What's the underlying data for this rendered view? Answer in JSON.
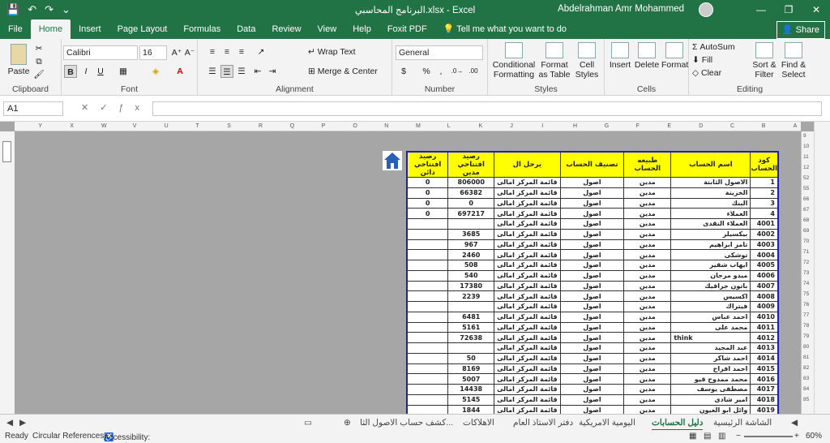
{
  "titlebar": {
    "title": "البرنامج المحاسبي.xlsx  -  Excel",
    "user": "Abdelrahman Amr Mohammed",
    "minimize": "—",
    "restore": "❐",
    "close": "✕"
  },
  "qat": {
    "save": "💾",
    "undo": "↶",
    "redo": "↷",
    "more": "⌄"
  },
  "tabs": [
    "File",
    "Home",
    "Insert",
    "Page Layout",
    "Formulas",
    "Data",
    "Review",
    "View",
    "Help",
    "Foxit PDF"
  ],
  "tell_me": "Tell me what you want to do",
  "share": "Share",
  "ribbon": {
    "clipboard": {
      "label": "Clipboard",
      "paste": "Paste"
    },
    "font": {
      "label": "Font",
      "name": "Calibri",
      "size": "16",
      "bold": "B",
      "italic": "I",
      "underline": "U"
    },
    "alignment": {
      "label": "Alignment",
      "wrap": "Wrap Text",
      "merge": "Merge & Center"
    },
    "number": {
      "label": "Number",
      "format": "General",
      "currency": "$",
      "percent": "%"
    },
    "styles": {
      "label": "Styles",
      "conditional": "Conditional Formatting",
      "format_table": "Format as Table",
      "cell_styles": "Cell Styles"
    },
    "cells": {
      "label": "Cells",
      "insert": "Insert",
      "delete": "Delete",
      "format": "Format"
    },
    "editing": {
      "label": "Editing",
      "autosum": "AutoSum",
      "fill": "Fill",
      "clear": "Clear",
      "sort": "Sort & Filter",
      "find": "Find & Select"
    }
  },
  "formula_bar": {
    "name_box": "A1",
    "value": ""
  },
  "columns": [
    "Y",
    "X",
    "W",
    "V",
    "U",
    "T",
    "S",
    "R",
    "Q",
    "P",
    "O",
    "N",
    "M",
    "L",
    "K",
    "J",
    "I",
    "H",
    "G",
    "F",
    "E",
    "D",
    "C",
    "B",
    "A"
  ],
  "rows": [
    "9",
    "10",
    "11",
    "12",
    "52",
    "55",
    "66",
    "67",
    "68",
    "69",
    "70",
    "71",
    "72",
    "73",
    "74",
    "75",
    "76",
    "77",
    "78",
    "79",
    "80",
    "81",
    "82",
    "83",
    "84",
    "85"
  ],
  "table": {
    "headers": [
      "كود الحساب",
      "اسم الحساب",
      "طبيعه الحساب",
      "تصنيف الحساب",
      "يرحل ال",
      "رصيد افتتاحي مدين",
      "رصيد افتتاحي دائن"
    ],
    "rows": [
      [
        "1",
        "الاصول الثابتة",
        "مدين",
        "اصول",
        "قائمة المركز امالى",
        "806000",
        "0"
      ],
      [
        "2",
        "الخزينة",
        "مدين",
        "اصول",
        "قائمة المركز امالى",
        "66382",
        "0"
      ],
      [
        "3",
        "البنك",
        "مدين",
        "اصول",
        "قائمة المركز امالى",
        "0",
        "0"
      ],
      [
        "4",
        "العملاء",
        "مدين",
        "اصول",
        "قائمة المركز امالى",
        "697217",
        "0"
      ],
      [
        "4001",
        "العملاء النقدى",
        "مدين",
        "اصول",
        "قائمة المركز امالى",
        "",
        ""
      ],
      [
        "4002",
        "بيكسيلز",
        "مدين",
        "اصول",
        "قائمة المركز امالى",
        "3685",
        ""
      ],
      [
        "4003",
        "تامر ابراهيم",
        "مدين",
        "اصول",
        "قائمة المركز امالى",
        "967",
        ""
      ],
      [
        "4004",
        "توشكى",
        "مدين",
        "اصول",
        "قائمة المركز امالى",
        "2460",
        ""
      ],
      [
        "4005",
        "ايهاب شقير",
        "مدين",
        "اصول",
        "قائمة المركز امالى",
        "508",
        ""
      ],
      [
        "4006",
        "ميدو مرجان",
        "مدين",
        "اصول",
        "قائمة المركز امالى",
        "540",
        ""
      ],
      [
        "4007",
        "باتون جرافيك",
        "مدين",
        "اصول",
        "قائمة المركز امالى",
        "17380",
        ""
      ],
      [
        "4008",
        "اكسيس",
        "مدين",
        "اصول",
        "قائمة المركز امالى",
        "2239",
        ""
      ],
      [
        "4009",
        "فيتراك",
        "مدين",
        "اصول",
        "قائمة المركز امالى",
        "",
        ""
      ],
      [
        "4010",
        "احمد عباس",
        "مدين",
        "اصول",
        "قائمة المركز امالى",
        "6481",
        ""
      ],
      [
        "4011",
        "محمد على",
        "مدين",
        "اصول",
        "قائمة المركز امالى",
        "5161",
        ""
      ],
      [
        "4012",
        "think",
        "مدين",
        "اصول",
        "قائمة المركز امالى",
        "72638",
        ""
      ],
      [
        "4013",
        "عبد المجيد",
        "مدين",
        "اصول",
        "قائمة المركز امالى",
        "",
        ""
      ],
      [
        "4014",
        "احمد شاكر",
        "مدين",
        "اصول",
        "قائمة المركز امالى",
        "50",
        ""
      ],
      [
        "4015",
        "احمد افراح",
        "مدين",
        "اصول",
        "قائمة المركز امالى",
        "8169",
        ""
      ],
      [
        "4016",
        "محمد ممدوح قيو",
        "مدين",
        "اصول",
        "قائمة المركز امالى",
        "5007",
        ""
      ],
      [
        "4017",
        "مصطفى يوسف",
        "مدين",
        "اصول",
        "قائمة المركز امالى",
        "14438",
        ""
      ],
      [
        "4018",
        "امير شادى",
        "مدين",
        "اصول",
        "قائمة المركز امالى",
        "5145",
        ""
      ],
      [
        "4019",
        "وائل ابو العيون",
        "مدين",
        "اصول",
        "قائمة المركز امالى",
        "1844",
        ""
      ]
    ]
  },
  "sheet_tabs": [
    "الشاشة الرئيسية",
    "دليل الحسابات",
    "اليومية الامريكية",
    "دفتر الاستاذ العام",
    "الاهلاكات",
    "كشف حساب الاصول الثا..."
  ],
  "active_sheet": "دليل الحسابات",
  "status": {
    "ready": "Ready",
    "circular": "Circular References",
    "accessibility": "Accessibility: Investigate",
    "zoom": "60%"
  },
  "colors": {
    "excel_green": "#217346",
    "header_yellow": "#ffff00",
    "table_border": "#1b1bd6",
    "sheet_gray": "#a6a6a6"
  }
}
